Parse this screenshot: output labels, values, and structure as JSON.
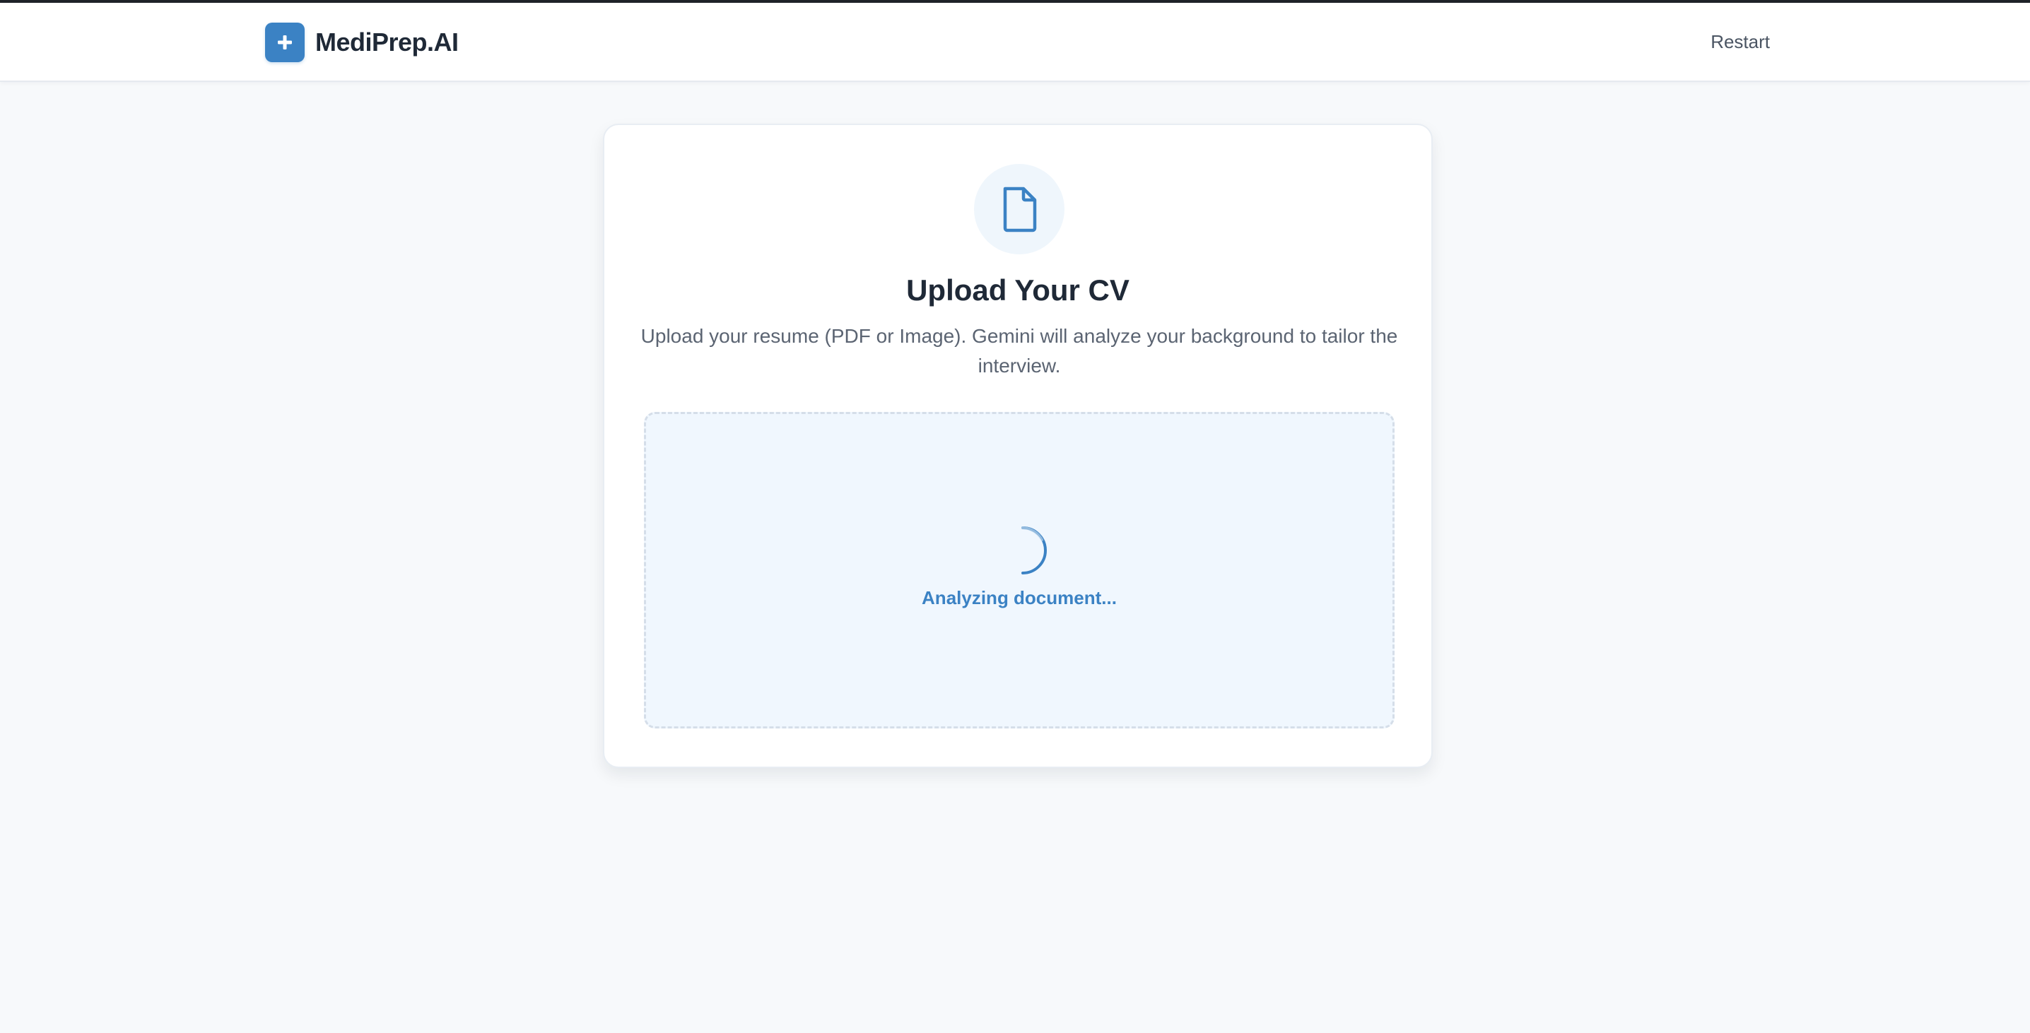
{
  "app": {
    "name": "MediPrep.AI",
    "logo_icon": "plus-icon",
    "accent_color": "#3b82c4"
  },
  "header": {
    "restart_label": "Restart"
  },
  "upload_card": {
    "icon": "file-icon",
    "title": "Upload Your CV",
    "description": "Upload your resume (PDF or Image). Gemini will analyze your background to tailor the interview.",
    "dropzone": {
      "state": "loading",
      "spinner_icon": "loading-spinner-icon",
      "status_text": "Analyzing document..."
    }
  }
}
